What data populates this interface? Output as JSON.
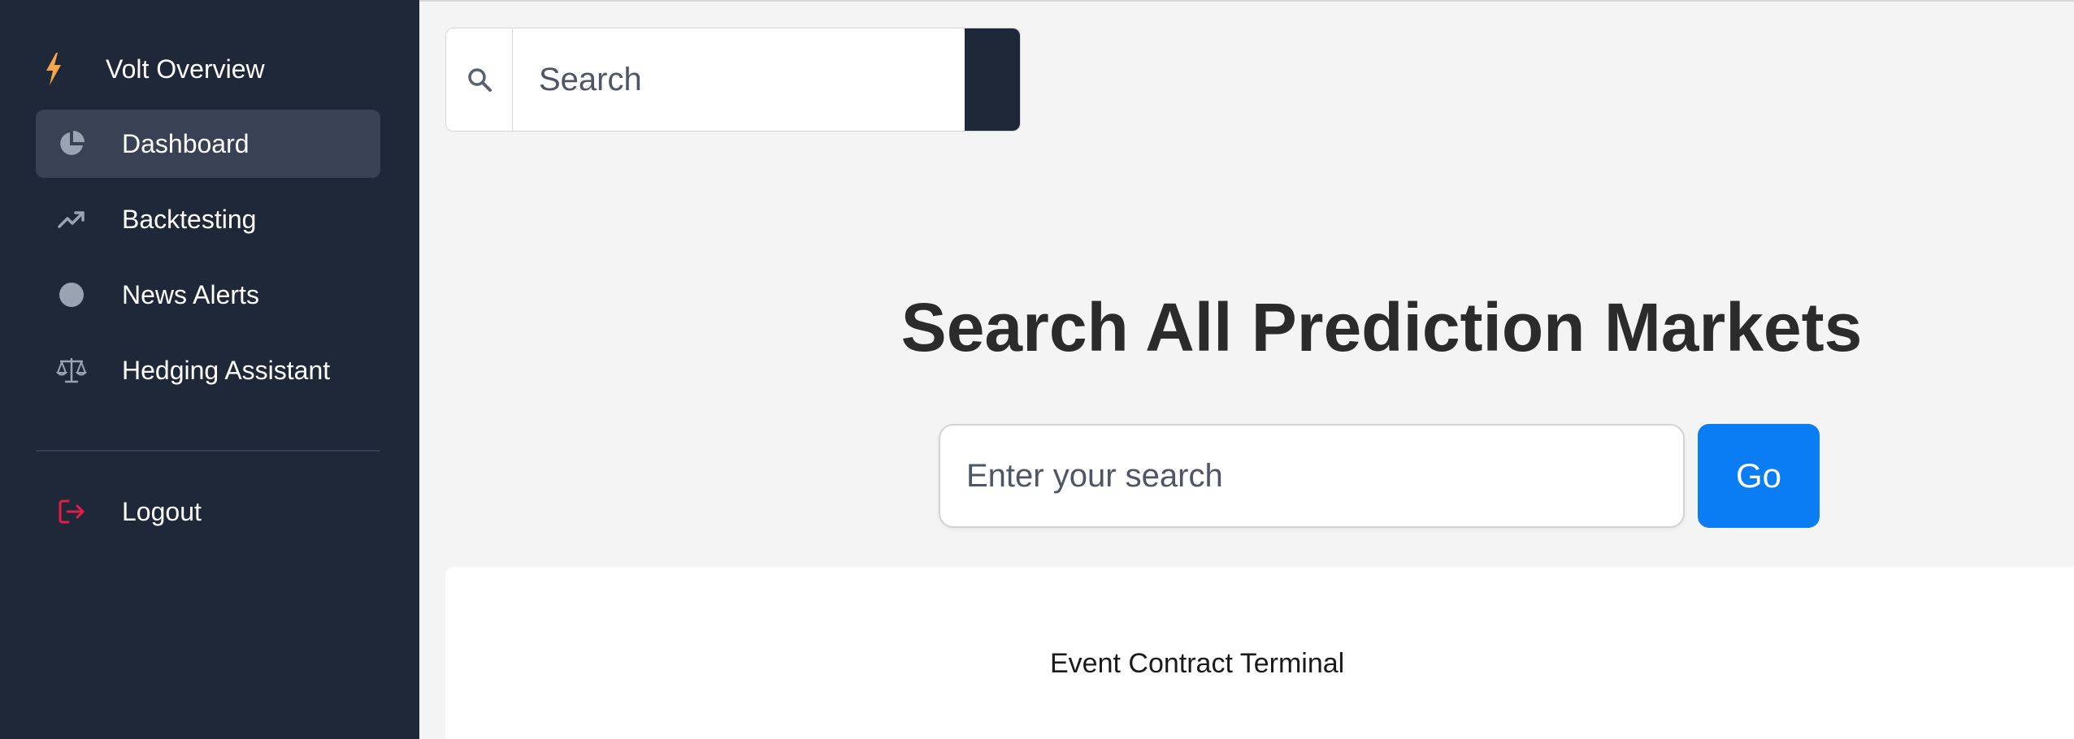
{
  "sidebar": {
    "brand": {
      "label": "Volt Overview",
      "icon": "bolt-icon",
      "icon_color": "#f5a54a"
    },
    "items": [
      {
        "label": "Dashboard",
        "icon": "pie-chart-icon",
        "active": true
      },
      {
        "label": "Backtesting",
        "icon": "trending-up-icon",
        "active": false
      },
      {
        "label": "News Alerts",
        "icon": "circle-icon",
        "active": false
      },
      {
        "label": "Hedging Assistant",
        "icon": "scale-icon",
        "active": false
      }
    ],
    "logout": {
      "label": "Logout",
      "icon": "logout-icon",
      "icon_color": "#e11d48"
    }
  },
  "top_search": {
    "placeholder": "Search",
    "icon": "search-icon"
  },
  "main": {
    "title": "Search All Prediction Markets",
    "search_placeholder": "Enter your search",
    "go_label": "Go"
  },
  "card": {
    "title": "Event Contract Terminal"
  },
  "colors": {
    "sidebar_bg": "#1f2838",
    "active_item_bg": "#384254",
    "accent": "#0a7df5",
    "page_bg": "#f4f4f4"
  }
}
